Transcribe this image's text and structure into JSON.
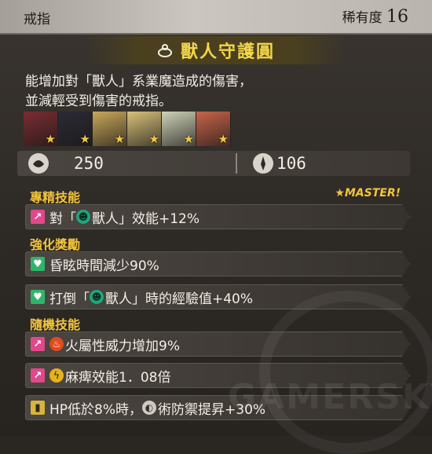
{
  "header": {
    "category": "戒指",
    "rarity_label": "稀有度",
    "rarity_value": "16"
  },
  "item": {
    "icon": "ring-icon",
    "name": "獸人守護圓",
    "description_line1": "能增加對「獸人」系業魔造成的傷害，",
    "description_line2": "並減輕受到傷害的戒指。"
  },
  "portraits": [
    {
      "name": "portrait-1",
      "color": "#7a2c32"
    },
    {
      "name": "portrait-2",
      "color": "#2b2a36"
    },
    {
      "name": "portrait-3",
      "color": "#caa85a"
    },
    {
      "name": "portrait-4",
      "color": "#d9c27a"
    },
    {
      "name": "portrait-5",
      "color": "#cfd3b8"
    },
    {
      "name": "portrait-6",
      "color": "#c8644a"
    }
  ],
  "stats": {
    "defense": "250",
    "attack": "106"
  },
  "sections": {
    "mastery_title": "專精技能",
    "master_badge": "★MASTER!",
    "bonus_title": "強化獎勵",
    "random_title": "隨機技能"
  },
  "skills": {
    "mastery": [
      "對「",
      "獸人」效能+12%"
    ],
    "bonus1": "昏眩時間減少90%",
    "bonus2": [
      "打倒「",
      "獸人」時的經驗值+40%"
    ],
    "random1": "火屬性威力增加9%",
    "random2": "麻痺效能1．08倍",
    "random3a": "HP低於8%時，",
    "random3b": "術防禦提昇+30%"
  },
  "watermark": "GAMERSKY",
  "colors": {
    "accent": "#f2c43e",
    "name": "#f3d64a"
  }
}
